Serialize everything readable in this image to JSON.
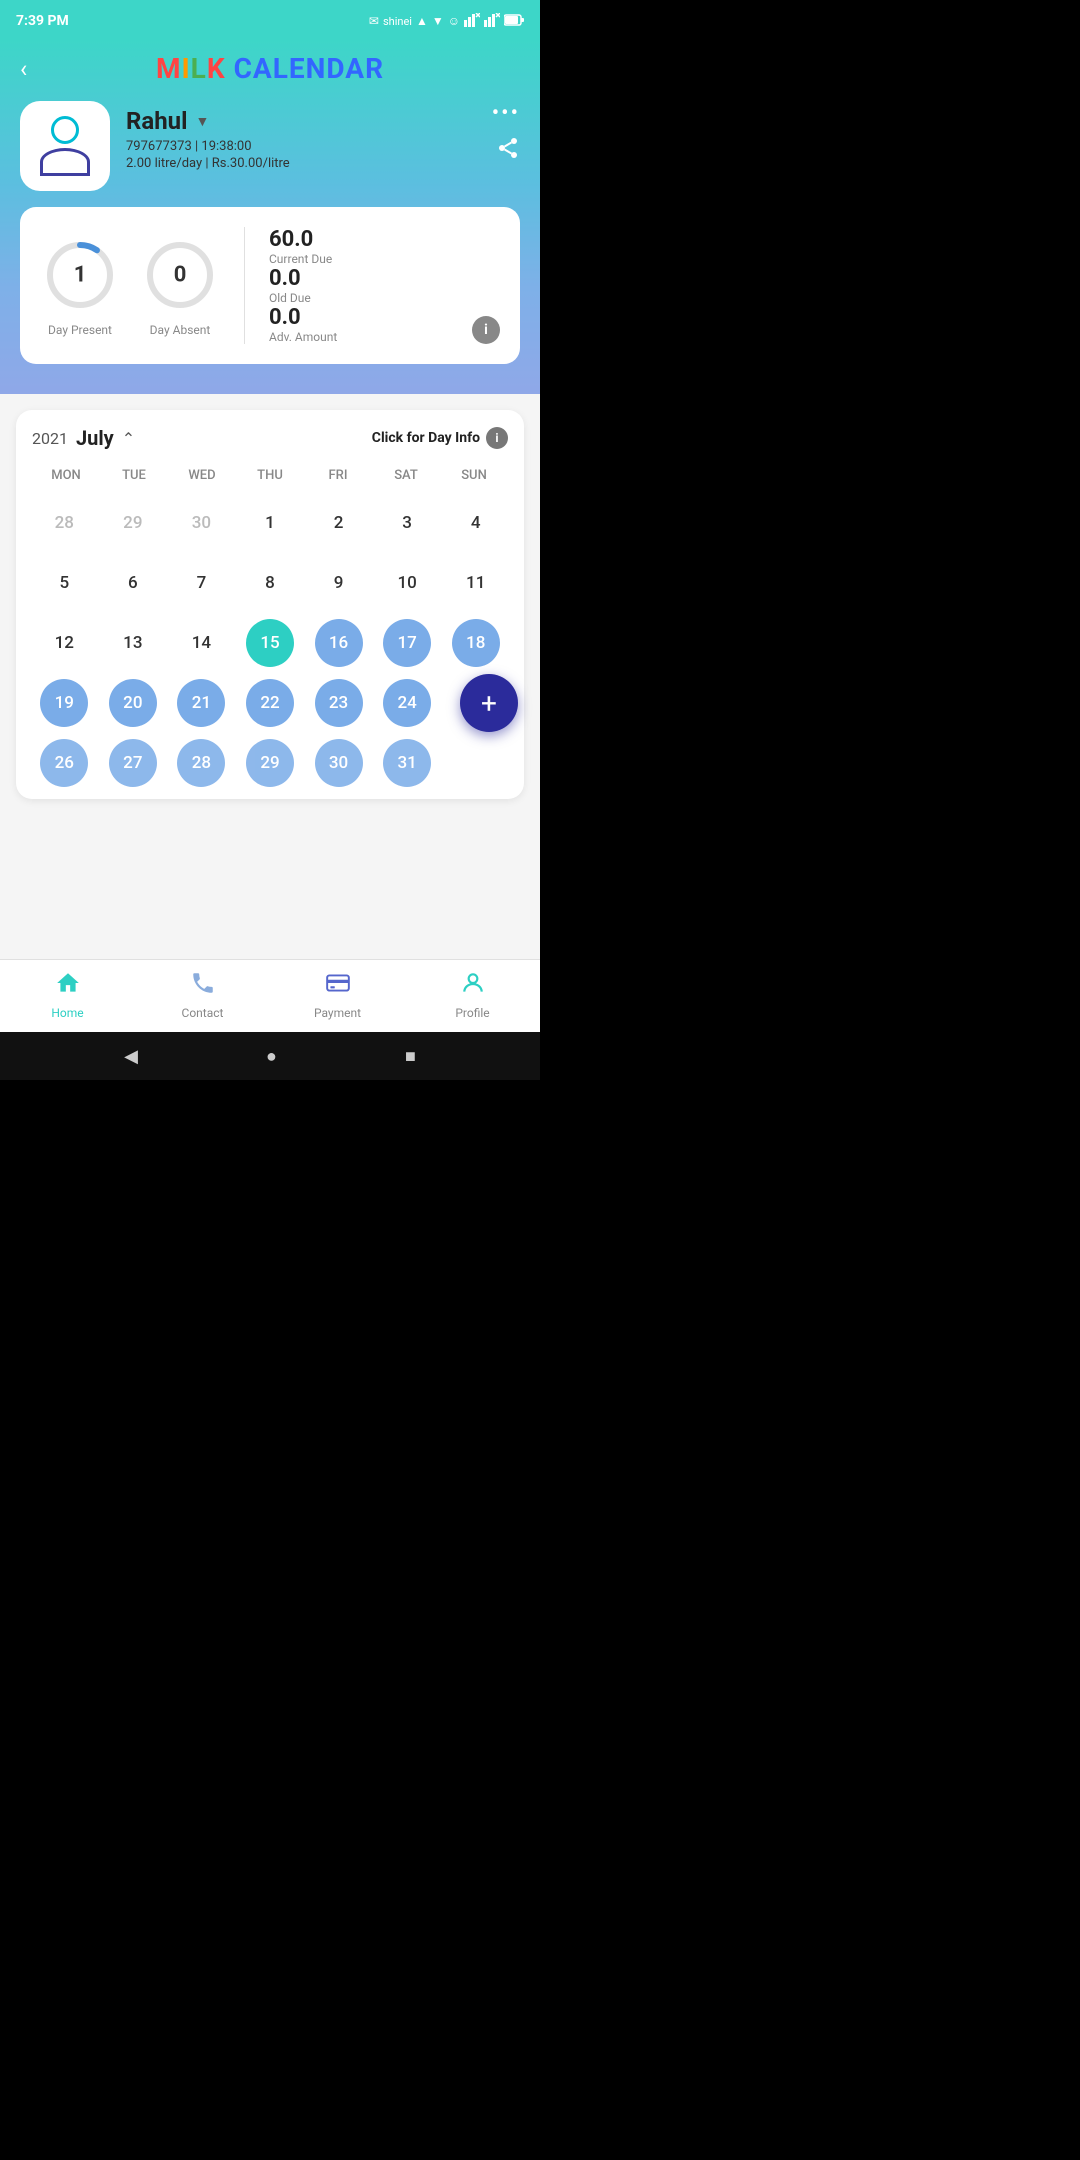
{
  "statusBar": {
    "time": "7:39 PM",
    "icons": [
      "msg",
      "shinei",
      "wifi",
      "signal1",
      "signal2",
      "battery"
    ]
  },
  "header": {
    "backLabel": "<",
    "titleParts": [
      "M",
      "I",
      "L",
      "K",
      " ",
      "CALENDAR"
    ],
    "titleColors": [
      "#ff4444",
      "#ff9900",
      "#4caf50",
      "#ff4444",
      "",
      "#3366ff"
    ]
  },
  "user": {
    "name": "Rahul",
    "phone": "797677373",
    "time": "19:38:00",
    "litre": "2.00 litre/day",
    "rate": "Rs.30.00/litre"
  },
  "stats": {
    "dayPresent": "1",
    "dayAbsent": "0",
    "dayPresentLabel": "Day Present",
    "dayAbsentLabel": "Day Absent",
    "currentDue": "60.0",
    "currentDueLabel": "Current Due",
    "oldDue": "0.0",
    "oldDueLabel": "Old Due",
    "advAmount": "0.0",
    "advAmountLabel": "Adv. Amount"
  },
  "calendar": {
    "year": "2021",
    "month": "July",
    "clickForDayInfo": "Click for Day Info",
    "dayNames": [
      "MON",
      "TUE",
      "WED",
      "THU",
      "FRI",
      "SAT",
      "SUN"
    ],
    "rows": [
      [
        {
          "num": "28",
          "type": "other"
        },
        {
          "num": "29",
          "type": "other"
        },
        {
          "num": "30",
          "type": "other"
        },
        {
          "num": "1",
          "type": "normal"
        },
        {
          "num": "2",
          "type": "normal"
        },
        {
          "num": "3",
          "type": "normal"
        },
        {
          "num": "4",
          "type": "normal"
        }
      ],
      [
        {
          "num": "5",
          "type": "normal"
        },
        {
          "num": "6",
          "type": "normal"
        },
        {
          "num": "7",
          "type": "normal"
        },
        {
          "num": "8",
          "type": "normal"
        },
        {
          "num": "9",
          "type": "normal"
        },
        {
          "num": "10",
          "type": "normal"
        },
        {
          "num": "11",
          "type": "normal"
        }
      ],
      [
        {
          "num": "12",
          "type": "normal"
        },
        {
          "num": "13",
          "type": "normal"
        },
        {
          "num": "14",
          "type": "normal"
        },
        {
          "num": "15",
          "type": "today"
        },
        {
          "num": "16",
          "type": "blue"
        },
        {
          "num": "17",
          "type": "blue"
        },
        {
          "num": "18",
          "type": "blue"
        }
      ],
      [
        {
          "num": "19",
          "type": "blue"
        },
        {
          "num": "20",
          "type": "blue"
        },
        {
          "num": "21",
          "type": "blue"
        },
        {
          "num": "22",
          "type": "blue"
        },
        {
          "num": "23",
          "type": "blue"
        },
        {
          "num": "24",
          "type": "blue"
        },
        {
          "num": "",
          "type": "fab"
        }
      ],
      [
        {
          "num": "26",
          "type": "blue-partial"
        },
        {
          "num": "27",
          "type": "blue-partial"
        },
        {
          "num": "28",
          "type": "blue-partial"
        },
        {
          "num": "29",
          "type": "blue-partial"
        },
        {
          "num": "30",
          "type": "blue-partial"
        },
        {
          "num": "31",
          "type": "blue-partial"
        },
        {
          "num": "",
          "type": "empty"
        }
      ]
    ]
  },
  "fab": {
    "label": "+"
  },
  "bottomNav": {
    "items": [
      {
        "icon": "home",
        "label": "Home",
        "active": true
      },
      {
        "icon": "phone",
        "label": "Contact",
        "active": false
      },
      {
        "icon": "payment",
        "label": "Payment",
        "active": false
      },
      {
        "icon": "person",
        "label": "Profile",
        "active": false
      }
    ]
  },
  "androidNav": {
    "back": "◀",
    "home": "●",
    "recent": "■"
  }
}
